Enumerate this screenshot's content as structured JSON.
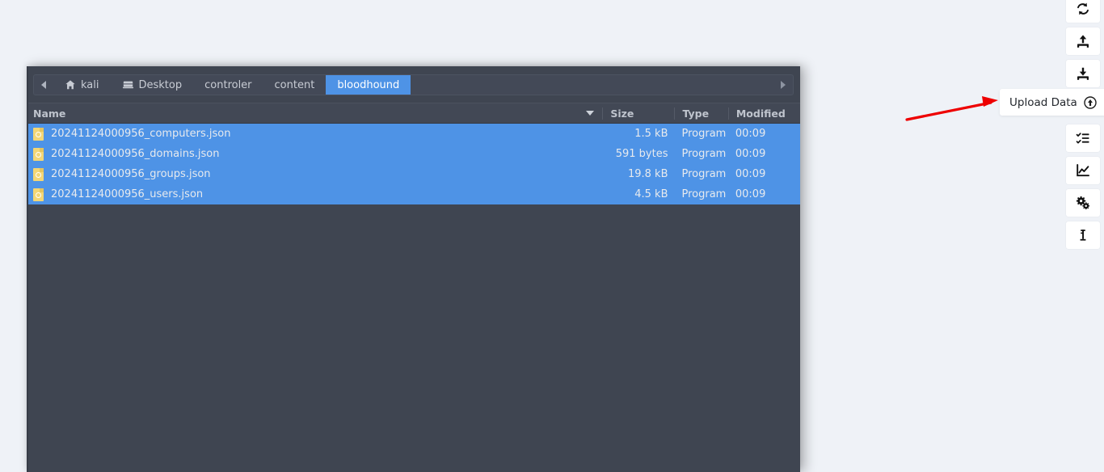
{
  "file_manager": {
    "pathbar": {
      "back_icon": "chevron-left-icon",
      "forward_icon": "chevron-right-icon",
      "crumbs": [
        {
          "label": "kali",
          "icon": "home-icon",
          "active": false
        },
        {
          "label": "Desktop",
          "icon": "desktop-icon",
          "active": false
        },
        {
          "label": "controler",
          "icon": "",
          "active": false
        },
        {
          "label": "content",
          "icon": "",
          "active": false
        },
        {
          "label": "bloodhound",
          "icon": "",
          "active": true
        }
      ]
    },
    "columns": {
      "name": "Name",
      "size": "Size",
      "type": "Type",
      "modified": "Modified",
      "sort_icon": "sort-descending-icon"
    },
    "files": [
      {
        "name": "20241124000956_computers.json",
        "size": "1.5 kB",
        "type": "Program",
        "modified": "00:09",
        "icon": "json-file-icon",
        "selected": true
      },
      {
        "name": "20241124000956_domains.json",
        "size": "591 bytes",
        "type": "Program",
        "modified": "00:09",
        "icon": "json-file-icon",
        "selected": true
      },
      {
        "name": "20241124000956_groups.json",
        "size": "19.8 kB",
        "type": "Program",
        "modified": "00:09",
        "icon": "json-file-icon",
        "selected": true
      },
      {
        "name": "20241124000956_users.json",
        "size": "4.5 kB",
        "type": "Program",
        "modified": "00:09",
        "icon": "json-file-icon",
        "selected": true
      }
    ],
    "colors": {
      "window_bg": "#3f4551",
      "header_bg": "#424855",
      "selection": "#4e93e6",
      "file_icon": "#f3d675"
    }
  },
  "tooltip": {
    "label": "Upload Data",
    "icon": "upload-circle-icon"
  },
  "icon_rail": {
    "buttons": [
      {
        "name": "refresh-icon",
        "title": "Refresh"
      },
      {
        "name": "upload-icon",
        "title": "Upload"
      },
      {
        "name": "download-icon",
        "title": "Download"
      },
      {
        "name": "upload-data-icon",
        "title": "Upload Data"
      },
      {
        "name": "checklist-icon",
        "title": "Checklist"
      },
      {
        "name": "chart-icon",
        "title": "Chart"
      },
      {
        "name": "settings-gears-icon",
        "title": "Settings"
      },
      {
        "name": "info-icon",
        "title": "Info"
      }
    ]
  },
  "annotation": {
    "arrow_color": "#ee0000"
  }
}
